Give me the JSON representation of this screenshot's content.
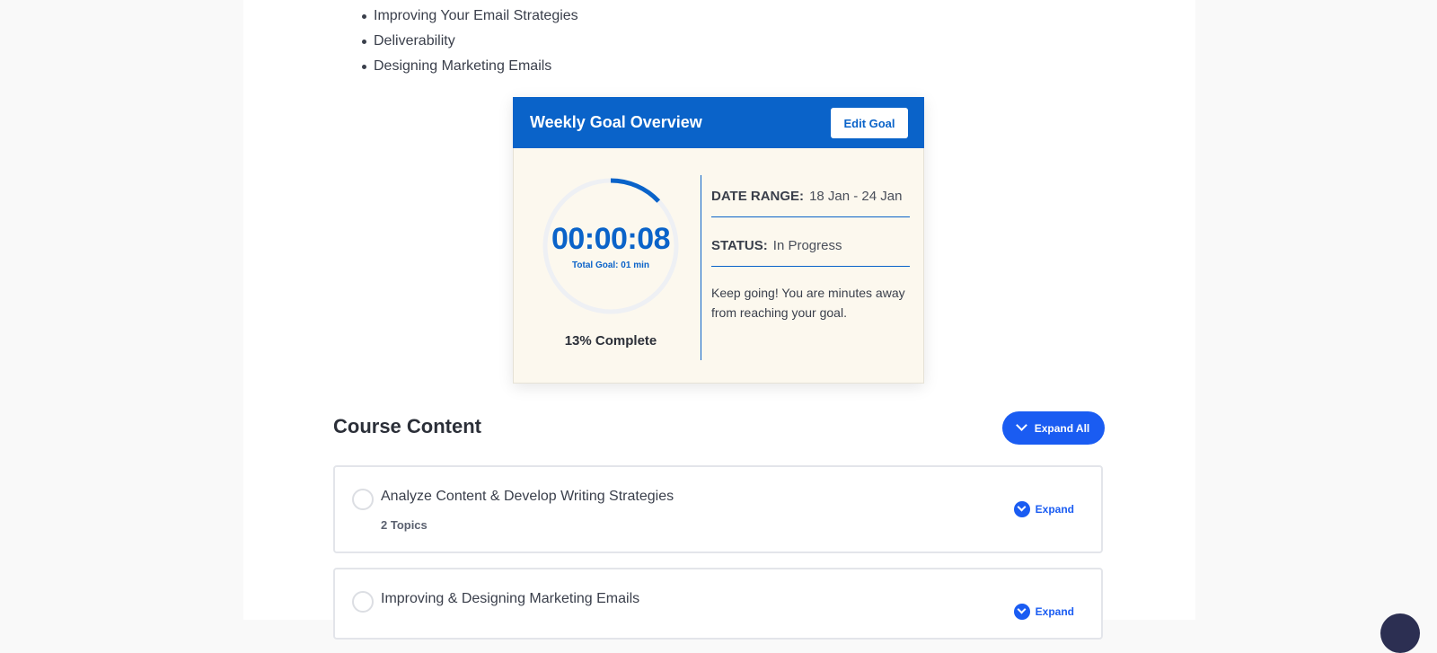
{
  "topics": [
    "Improving Your Email Strategies",
    "Deliverability",
    "Designing Marketing Emails"
  ],
  "goal_card": {
    "title": "Weekly Goal Overview",
    "edit_label": "Edit Goal",
    "timer": "00:00:08",
    "total_goal": "Total Goal: 01 min",
    "percent_complete": "13% Complete",
    "progress_fraction": 0.13,
    "date_range_label": "DATE RANGE:",
    "date_range_value": "18 Jan - 24 Jan",
    "status_label": "STATUS:",
    "status_value": "In Progress",
    "message": "Keep going! You are minutes away from reaching your goal.",
    "accent_color": "#0a63c9"
  },
  "course": {
    "title": "Course Content",
    "expand_all_label": "Expand All",
    "lessons": [
      {
        "title": "Analyze Content & Develop Writing Strategies",
        "topics": "2 Topics",
        "expand_label": "Expand"
      },
      {
        "title": "Improving & Designing Marketing Emails",
        "topics": "",
        "expand_label": "Expand"
      }
    ]
  }
}
